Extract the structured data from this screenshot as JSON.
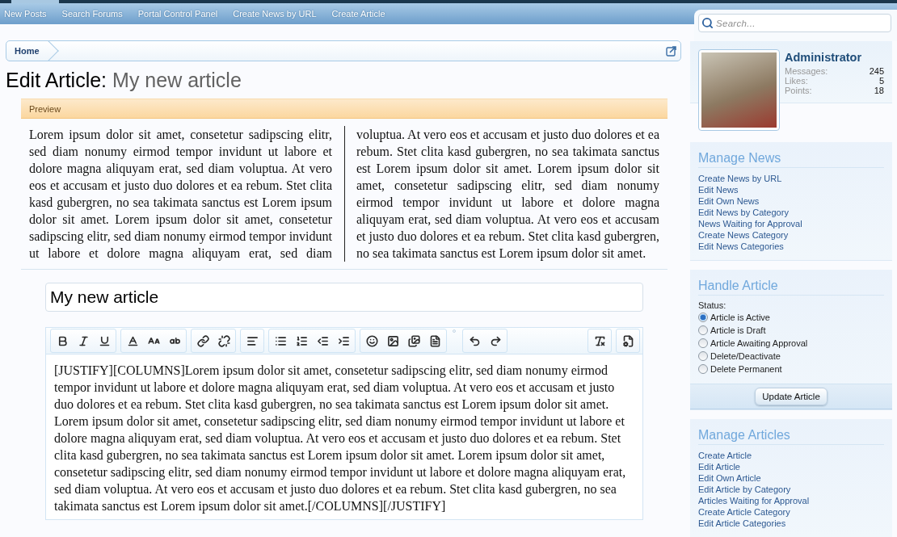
{
  "nav_links": [
    "New Posts",
    "Search Forums",
    "Portal Control Panel",
    "Create News by URL",
    "Create Article"
  ],
  "breadcrumb": {
    "items": [
      "Home"
    ]
  },
  "page_title": {
    "prefix": "Edit Article:",
    "subject": "My new article"
  },
  "preview": {
    "header": "Preview",
    "text": "Lorem ipsum dolor sit amet, consetetur sadipscing elitr, sed diam nonumy eirmod tempor invidunt ut labore et dolore magna aliquyam erat, sed diam voluptua. At vero eos et accusam et justo duo dolores et ea rebum. Stet clita kasd gubergren, no sea takimata sanctus est Lorem ipsum dolor sit amet. Lorem ipsum dolor sit amet, consetetur sadipscing elitr, sed diam nonumy eirmod tempor invidunt ut labore et dolore magna aliquyam erat, sed diam voluptua. At vero eos et accusam et justo duo dolores et ea rebum. Stet clita kasd gubergren, no sea takimata sanctus est Lorem ipsum dolor sit amet. Lorem ipsum dolor sit amet, consetetur sadipscing elitr, sed diam nonumy eirmod tempor invidunt ut labore et dolore magna aliquyam erat, sed diam voluptua. At vero eos et accusam et justo duo dolores et ea rebum. Stet clita kasd gubergren, no sea takimata sanctus est Lorem ipsum dolor sit amet."
  },
  "title_field": {
    "value": "My new article"
  },
  "editor": {
    "content": "[JUSTIFY][COLUMNS]Lorem ipsum dolor sit amet, consetetur sadipscing elitr, sed diam nonumy eirmod tempor invidunt ut labore et dolore magna aliquyam erat, sed diam voluptua. At vero eos et accusam et justo duo dolores et ea rebum. Stet clita kasd gubergren, no sea takimata sanctus est Lorem ipsum dolor sit amet. Lorem ipsum dolor sit amet, consetetur sadipscing elitr, sed diam nonumy eirmod tempor invidunt ut labore et dolore magna aliquyam erat, sed diam voluptua. At vero eos et accusam et justo duo dolores et ea rebum. Stet clita kasd gubergren, no sea takimata sanctus est Lorem ipsum dolor sit amet. Lorem ipsum dolor sit amet, consetetur sadipscing elitr, sed diam nonumy eirmod tempor invidunt ut labore et dolore magna aliquyam erat, sed diam voluptua. At vero eos et accusam et justo duo dolores et ea rebum. Stet clita kasd gubergren, no sea takimata sanctus est Lorem ipsum dolor sit amet.[/COLUMNS][/JUSTIFY]"
  },
  "sidebar": {
    "search": {
      "placeholder": "Search..."
    },
    "profile": {
      "name": "Administrator",
      "stats": [
        {
          "label": "Messages:",
          "value": "245"
        },
        {
          "label": "Likes:",
          "value": "5"
        },
        {
          "label": "Points:",
          "value": "18"
        }
      ]
    },
    "blocks": [
      {
        "kind": "links",
        "title": "Manage News",
        "links": [
          "Create News by URL",
          "Edit News",
          "Edit Own News",
          "Edit News by Category",
          "News Waiting for Approval",
          "Create News Category",
          "Edit News Categories"
        ]
      },
      {
        "kind": "status",
        "title": "Handle Article",
        "label": "Status:",
        "options": [
          {
            "label": "Article is Active",
            "selected": true
          },
          {
            "label": "Article is Draft",
            "selected": false
          },
          {
            "label": "Article Awaiting Approval",
            "selected": false
          },
          {
            "label": "Delete/Deactivate",
            "selected": false
          },
          {
            "label": "Delete Permanent",
            "selected": false
          }
        ],
        "button": "Update Article"
      },
      {
        "kind": "links",
        "title": "Manage Articles",
        "links": [
          "Create Article",
          "Edit Article",
          "Edit Own Article",
          "Edit Article by Category",
          "Articles Waiting for Approval",
          "Create Article Category",
          "Edit Article Categories"
        ]
      }
    ]
  }
}
